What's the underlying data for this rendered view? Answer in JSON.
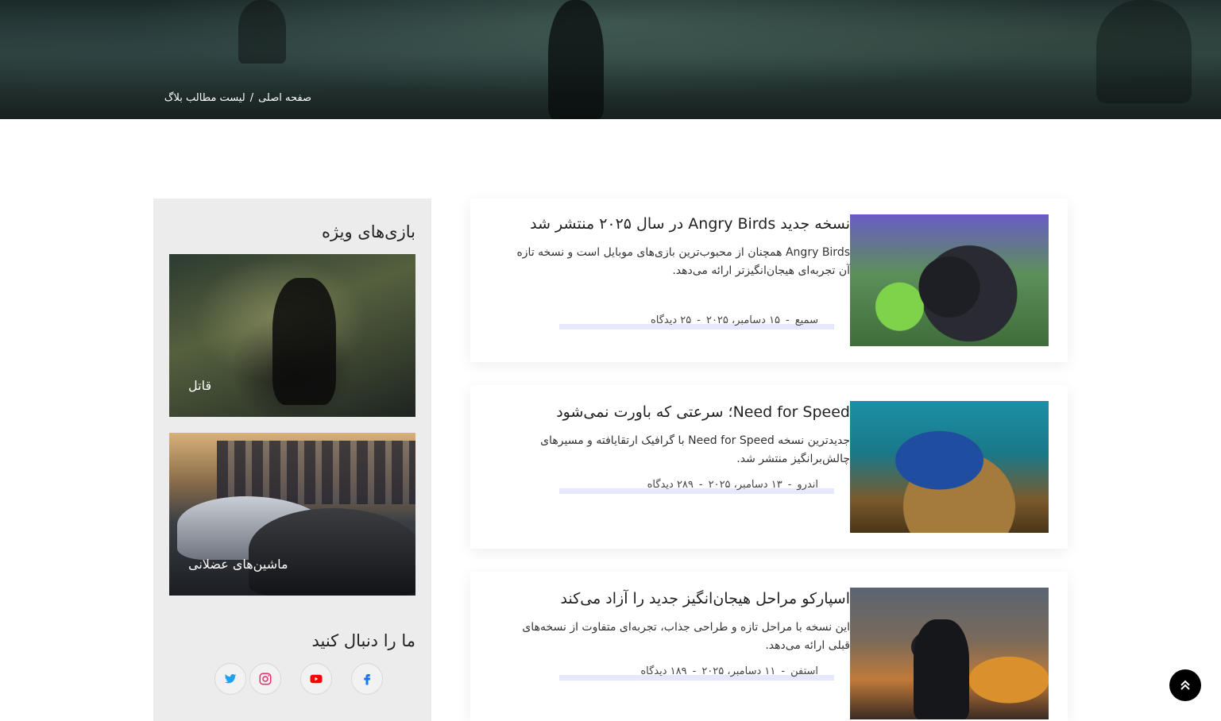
{
  "breadcrumb": {
    "home": "صفحه اصلی",
    "separator": "/",
    "current": "لیست مطالب بلاگ"
  },
  "sidebar": {
    "featured_title": "بازی‌های ویژه",
    "featured_games": [
      {
        "label": "قاتل"
      },
      {
        "label": "ماشین‌های عضلانی"
      }
    ],
    "follow_title": "ما را دنبال کنید",
    "socials": [
      {
        "name": "twitter-icon",
        "color": "#1da1f2"
      },
      {
        "name": "instagram-icon",
        "color": "#e1306c"
      },
      {
        "name": "youtube-icon",
        "color": "#ff0000"
      },
      {
        "name": "facebook-icon",
        "color": "#1877f2"
      }
    ]
  },
  "posts": [
    {
      "title": "نسخه جدید Angry Birds در سال ۲۰۲۵ منتشر شد",
      "excerpt": "Angry Birds همچنان از محبوب‌ترین بازی‌های موبایل است و نسخه تازه آن تجربه‌ای هیجان‌انگیزتر ارائه می‌دهد.",
      "author": "سمیع",
      "date": "۱۵ دسامبر، ۲۰۲۵",
      "views": "۲۵ دیدگاه"
    },
    {
      "title": "Need for Speed؛ سرعتی که باورت نمی‌شود",
      "excerpt": "جدیدترین نسخه Need for Speed با گرافیک ارتقایافته و مسیرهای چالش‌برانگیز منتشر شد.",
      "author": "اندرو",
      "date": "۱۳ دسامبر، ۲۰۲۵",
      "views": "۲۸۹ دیدگاه"
    },
    {
      "title": "اسپارکو مراحل هیجان‌انگیز جدید را آزاد می‌کند",
      "excerpt": "این نسخه با مراحل تازه و طراحی جذاب، تجربه‌ای متفاوت از نسخه‌های قبلی ارائه می‌دهد.",
      "author": "استفن",
      "date": "۱۱ دسامبر، ۲۰۲۵",
      "views": "۱۸۹ دیدگاه"
    }
  ],
  "meta_separator": "-",
  "colors": {
    "sidebar_bg": "#ececec",
    "meta_highlight": "#e6e9fb",
    "back_to_top": "#000000"
  },
  "icons": {
    "back_to_top": "double-chevron-up-icon"
  }
}
